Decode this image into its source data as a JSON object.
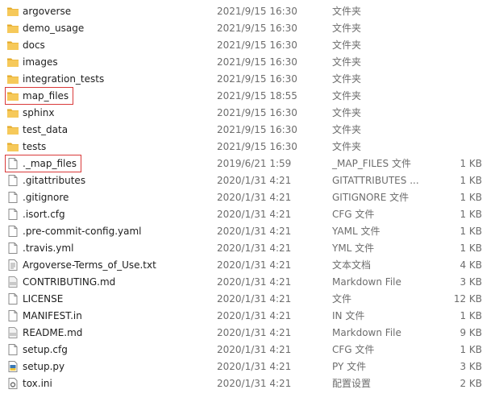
{
  "files": [
    {
      "name": "argoverse",
      "date": "2021/9/15 16:30",
      "type": "文件夹",
      "size": "",
      "icon": "folder-icon"
    },
    {
      "name": "demo_usage",
      "date": "2021/9/15 16:30",
      "type": "文件夹",
      "size": "",
      "icon": "folder-icon"
    },
    {
      "name": "docs",
      "date": "2021/9/15 16:30",
      "type": "文件夹",
      "size": "",
      "icon": "folder-icon"
    },
    {
      "name": "images",
      "date": "2021/9/15 16:30",
      "type": "文件夹",
      "size": "",
      "icon": "folder-icon"
    },
    {
      "name": "integration_tests",
      "date": "2021/9/15 16:30",
      "type": "文件夹",
      "size": "",
      "icon": "folder-icon"
    },
    {
      "name": "map_files",
      "date": "2021/9/15 18:55",
      "type": "文件夹",
      "size": "",
      "icon": "folder-icon",
      "highlighted": true
    },
    {
      "name": "sphinx",
      "date": "2021/9/15 16:30",
      "type": "文件夹",
      "size": "",
      "icon": "folder-icon"
    },
    {
      "name": "test_data",
      "date": "2021/9/15 16:30",
      "type": "文件夹",
      "size": "",
      "icon": "folder-icon"
    },
    {
      "name": "tests",
      "date": "2021/9/15 16:30",
      "type": "文件夹",
      "size": "",
      "icon": "folder-icon"
    },
    {
      "name": "._map_files",
      "date": "2019/6/21 1:59",
      "type": "_MAP_FILES 文件",
      "size": "1 KB",
      "icon": "file-icon",
      "highlighted": true
    },
    {
      "name": ".gitattributes",
      "date": "2020/1/31 4:21",
      "type": "GITATTRIBUTES ...",
      "size": "1 KB",
      "icon": "file-icon"
    },
    {
      "name": ".gitignore",
      "date": "2020/1/31 4:21",
      "type": "GITIGNORE 文件",
      "size": "1 KB",
      "icon": "file-icon"
    },
    {
      "name": ".isort.cfg",
      "date": "2020/1/31 4:21",
      "type": "CFG 文件",
      "size": "1 KB",
      "icon": "file-icon"
    },
    {
      "name": ".pre-commit-config.yaml",
      "date": "2020/1/31 4:21",
      "type": "YAML 文件",
      "size": "1 KB",
      "icon": "file-icon"
    },
    {
      "name": ".travis.yml",
      "date": "2020/1/31 4:21",
      "type": "YML 文件",
      "size": "1 KB",
      "icon": "file-icon"
    },
    {
      "name": "Argoverse-Terms_of_Use.txt",
      "date": "2020/1/31 4:21",
      "type": "文本文档",
      "size": "4 KB",
      "icon": "text-file-icon"
    },
    {
      "name": "CONTRIBUTING.md",
      "date": "2020/1/31 4:21",
      "type": "Markdown File",
      "size": "3 KB",
      "icon": "markdown-file-icon"
    },
    {
      "name": "LICENSE",
      "date": "2020/1/31 4:21",
      "type": "文件",
      "size": "12 KB",
      "icon": "file-icon"
    },
    {
      "name": "MANIFEST.in",
      "date": "2020/1/31 4:21",
      "type": "IN 文件",
      "size": "1 KB",
      "icon": "file-icon"
    },
    {
      "name": "README.md",
      "date": "2020/1/31 4:21",
      "type": "Markdown File",
      "size": "9 KB",
      "icon": "markdown-file-icon"
    },
    {
      "name": "setup.cfg",
      "date": "2020/1/31 4:21",
      "type": "CFG 文件",
      "size": "1 KB",
      "icon": "file-icon"
    },
    {
      "name": "setup.py",
      "date": "2020/1/31 4:21",
      "type": "PY 文件",
      "size": "3 KB",
      "icon": "python-file-icon"
    },
    {
      "name": "tox.ini",
      "date": "2020/1/31 4:21",
      "type": "配置设置",
      "size": "2 KB",
      "icon": "settings-file-icon"
    }
  ],
  "colors": {
    "folder": "#f6c95a",
    "folder_dark": "#e3a826",
    "highlight_border": "#d93a3a",
    "date_text": "#6d6d6d"
  }
}
